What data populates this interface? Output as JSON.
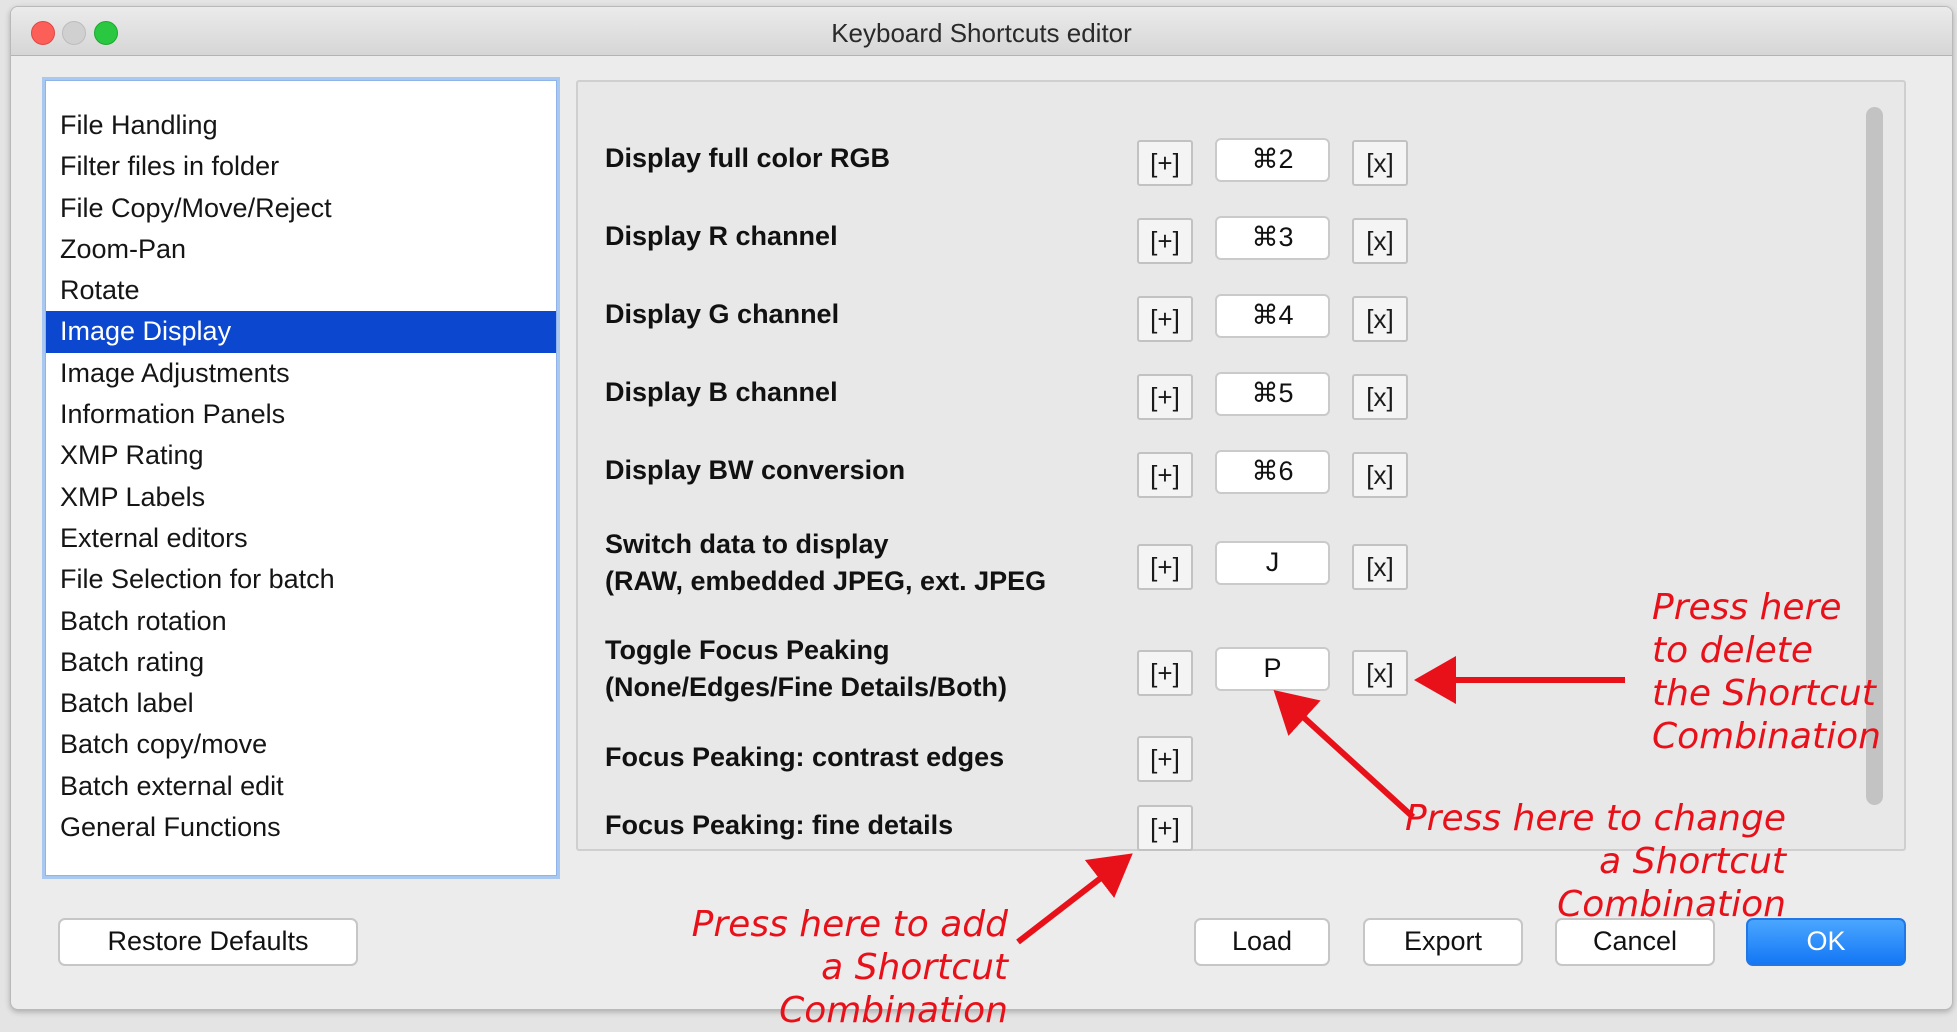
{
  "window": {
    "title": "Keyboard Shortcuts editor"
  },
  "categories": [
    "File Handling",
    "Filter files in folder",
    "File Copy/Move/Reject",
    "Zoom-Pan",
    "Rotate",
    "Image Display",
    "Image Adjustments",
    "Information Panels",
    "XMP Rating",
    "XMP Labels",
    "External editors",
    "File Selection for batch",
    "Batch rotation",
    "Batch rating",
    "Batch label",
    "Batch copy/move",
    "Batch external edit",
    "General Functions"
  ],
  "selected_category": "Image Display",
  "shortcuts": [
    {
      "line1": "Display full color RGB",
      "line2": "",
      "key": "⌘2"
    },
    {
      "line1": "Display R channel",
      "line2": "",
      "key": "⌘3"
    },
    {
      "line1": "Display G channel",
      "line2": "",
      "key": "⌘4"
    },
    {
      "line1": "Display B channel",
      "line2": "",
      "key": "⌘5"
    },
    {
      "line1": "Display BW conversion",
      "line2": "",
      "key": "⌘6"
    },
    {
      "line1": "Switch data to display",
      "line2": "(RAW, embedded JPEG, ext. JPEG",
      "key": "J"
    },
    {
      "line1": "Toggle Focus Peaking",
      "line2": "(None/Edges/Fine Details/Both)",
      "key": "P"
    },
    {
      "line1": "Focus Peaking: contrast edges",
      "line2": "",
      "key": ""
    },
    {
      "line1": "Focus Peaking: fine details",
      "line2": "",
      "key": ""
    }
  ],
  "add_label": "[+]",
  "delete_label": "[x]",
  "buttons": {
    "restore_defaults": "Restore Defaults",
    "load": "Load",
    "export": "Export",
    "cancel": "Cancel",
    "ok": "OK"
  },
  "annotations": {
    "delete": [
      "Press here",
      "to delete",
      "the Shortcut",
      "Combination"
    ],
    "change": [
      "Press here to change",
      "a Shortcut Combination"
    ],
    "add": [
      "Press here to add",
      "a Shortcut Combination"
    ]
  },
  "colors": {
    "selection": "#0b47cf",
    "annotation": "#e8111a",
    "ok_button": "#1477f5"
  }
}
